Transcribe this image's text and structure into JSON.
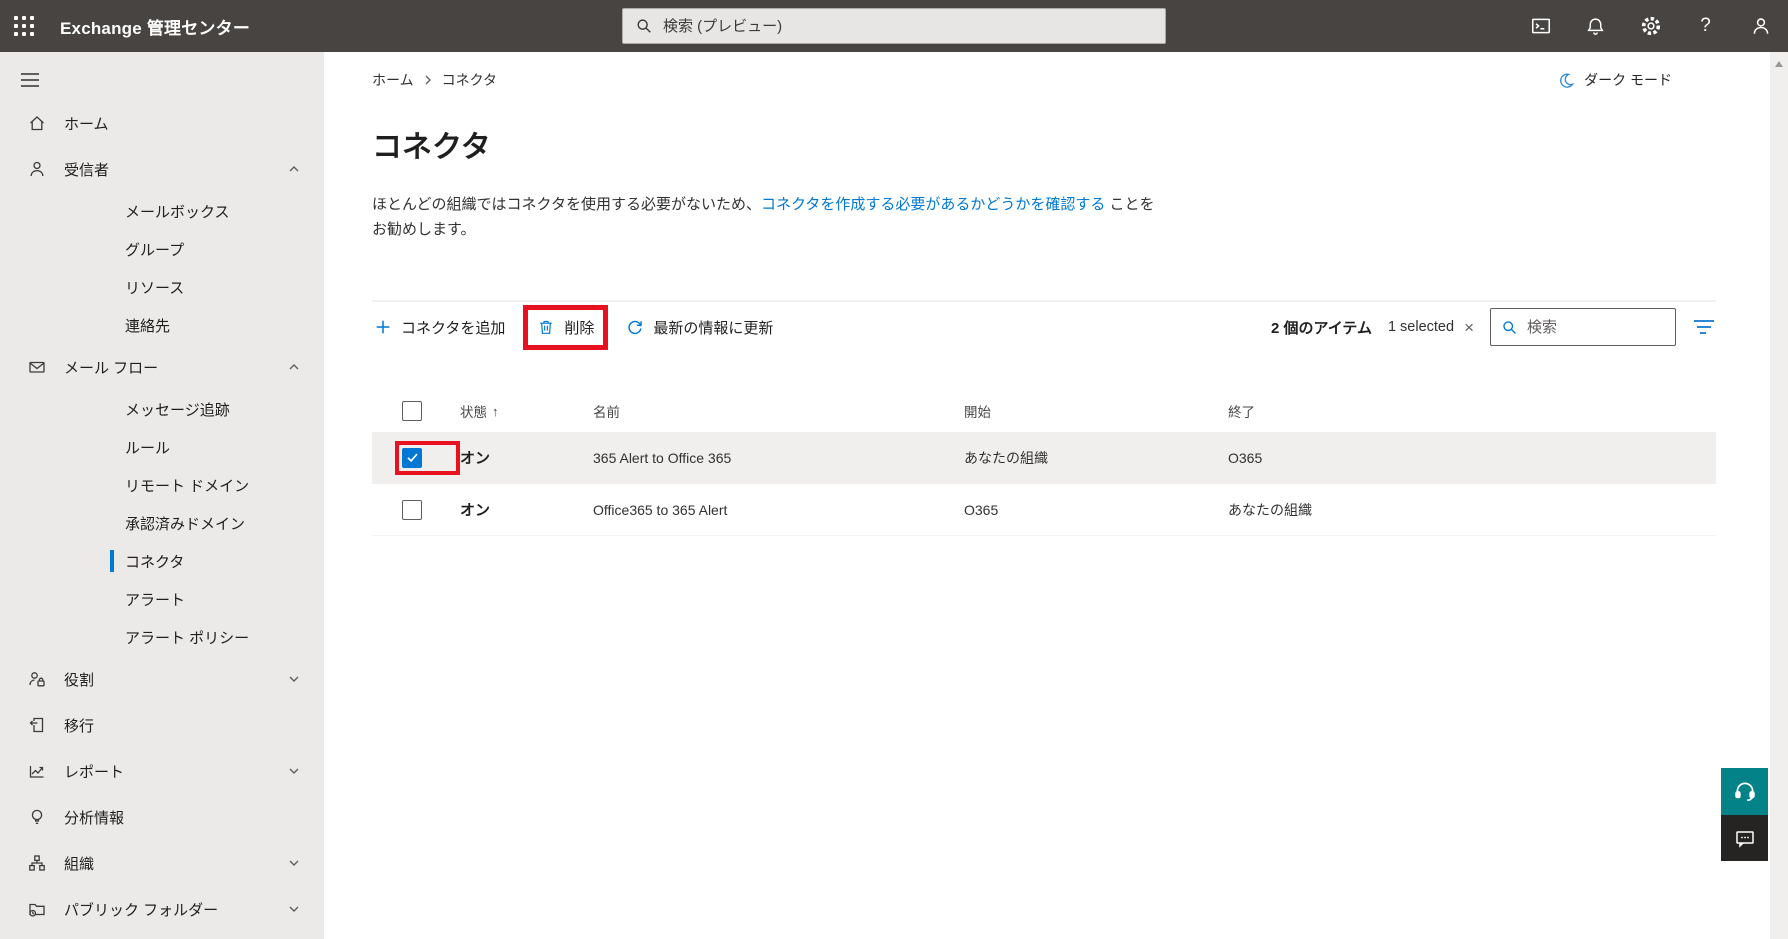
{
  "topbar": {
    "app_title": "Exchange 管理センター",
    "search_placeholder": "検索 (プレビュー)",
    "icons": [
      "cloud-shell-icon",
      "notifications-bell-icon",
      "settings-gear-icon",
      "help-icon",
      "account-person-icon"
    ],
    "help_glyph": "?"
  },
  "sidebar": {
    "items": [
      {
        "label": "ホーム",
        "icon": "home-icon"
      },
      {
        "label": "受信者",
        "icon": "person-icon",
        "expanded": true
      },
      {
        "label": "メールボックス",
        "sub": true
      },
      {
        "label": "グループ",
        "sub": true
      },
      {
        "label": "リソース",
        "sub": true
      },
      {
        "label": "連絡先",
        "sub": true
      },
      {
        "label": "メール フロー",
        "icon": "mail-icon",
        "expanded": true
      },
      {
        "label": "メッセージ追跡",
        "sub": true
      },
      {
        "label": "ルール",
        "sub": true
      },
      {
        "label": "リモート ドメイン",
        "sub": true
      },
      {
        "label": "承認済みドメイン",
        "sub": true
      },
      {
        "label": "コネクタ",
        "sub": true,
        "selected": true
      },
      {
        "label": "アラート",
        "sub": true
      },
      {
        "label": "アラート ポリシー",
        "sub": true
      },
      {
        "label": "役割",
        "icon": "roles-icon",
        "expanded": false
      },
      {
        "label": "移行",
        "icon": "migration-icon"
      },
      {
        "label": "レポート",
        "icon": "reports-icon",
        "expanded": false
      },
      {
        "label": "分析情報",
        "icon": "insights-icon"
      },
      {
        "label": "組織",
        "icon": "organization-icon",
        "expanded": false
      },
      {
        "label": "パブリック フォルダー",
        "icon": "folder-icon",
        "expanded": false
      }
    ]
  },
  "page": {
    "breadcrumb": [
      "ホーム",
      "コネクタ"
    ],
    "dark_mode_label": "ダーク モード",
    "title": "コネクタ",
    "description": {
      "prefix": "ほとんどの組織ではコネクタを使用する必要がないため、",
      "link": "コネクタを作成する必要があるかどうかを確認する",
      "suffix": " ことを",
      "line2": "お勧めします。"
    }
  },
  "commandbar": {
    "add_label": "コネクタを追加",
    "delete_label": "削除",
    "refresh_label": "最新の情報に更新",
    "items_count": "2 個のアイテム",
    "selected_count": "1 selected",
    "clear_glyph": "×",
    "search_placeholder": "検索"
  },
  "table": {
    "headers": {
      "status": "状態",
      "name": "名前",
      "start": "開始",
      "end": "終了"
    },
    "sort_icon": "↑",
    "rows": [
      {
        "status": "オン",
        "name": "365 Alert to Office 365",
        "start": "あなたの組織",
        "end": "O365",
        "selected": true
      },
      {
        "status": "オン",
        "name": "Office365 to 365 Alert",
        "start": "O365",
        "end": "あなたの組織",
        "selected": false
      }
    ]
  },
  "colors": {
    "accent_blue": "#0078d4",
    "annotation_red": "#e8111f",
    "topbar_gray": "#474442",
    "sidebar_gray": "#ebeae9",
    "selected_row": "#f0efee",
    "support_teal": "#038387",
    "feedback_dark": "#252423"
  }
}
